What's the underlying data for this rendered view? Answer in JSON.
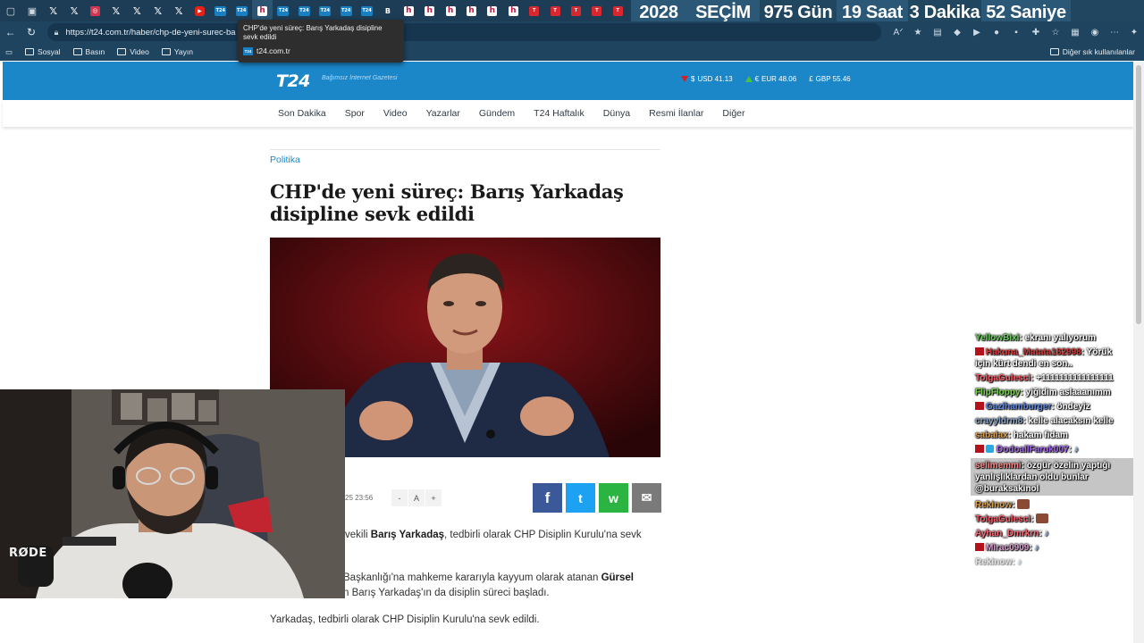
{
  "browser": {
    "countdown": [
      {
        "label": "2028",
        "alt": true
      },
      {
        "label": "SEÇİM",
        "alt": true
      },
      {
        "label": "975 Gün",
        "alt": false
      },
      {
        "label": "19 Saat",
        "alt": true
      },
      {
        "label": "3 Dakika",
        "alt": false
      },
      {
        "label": "52 Saniye",
        "alt": true
      }
    ],
    "url": "https://t24.com.tr/haber/chp-de-yeni-surec-ba",
    "tooltip": {
      "title": "CHP'de yeni süreç: Barış Yarkadaş disipline sevk edildi",
      "host": "t24.com.tr",
      "favicon_text": "T24"
    },
    "bookmarks": [
      "Sosyal",
      "Basın",
      "Video",
      "Yayın"
    ],
    "bookmarks_other": "Diğer sık kullanılanlar"
  },
  "site": {
    "logo": "T24",
    "slogan": "Bağımsız İnternet Gazetesi",
    "rates": [
      {
        "symbol": "$",
        "label": "USD 41.13",
        "trend": "down"
      },
      {
        "symbol": "€",
        "label": "EUR 48.06",
        "trend": "up"
      },
      {
        "symbol": "£",
        "label": "GBP 55.46",
        "trend": "none"
      }
    ],
    "nav": [
      "Son Dakika",
      "Spor",
      "Video",
      "Yazarlar",
      "Gündem",
      "T24 Haftalık",
      "Dünya",
      "Resmi İlanlar",
      "Diğer"
    ]
  },
  "article": {
    "category": "Politika",
    "headline": "CHP'de yeni süreç: Barış Yarkadaş disipline sevk edildi",
    "date_fragment": "25 23:56",
    "font_controls": [
      "-",
      "A",
      "+"
    ],
    "share": {
      "facebook": "f",
      "twitter": "t",
      "whatsapp": "w",
      "mail": "✉"
    },
    "paragraphs": {
      "p1_pre": "vekili ",
      "p1_bold": "Barış Yarkadaş",
      "p1_post": ", tedbirli olarak CHP Disiplin Kurulu'na sevk",
      "p2_pre": "Başkanlığı'na mahkeme kararıyla kayyum olarak atanan ",
      "p2_bold": "Gürsel",
      "p2_line2": "n Barış Yarkadaş'ın da disiplin süreci başladı.",
      "p3": "Yarkadaş, tedbirli olarak CHP Disiplin Kurulu'na sevk edildi."
    }
  },
  "overlay": {
    "webcam_brand": "RØDE"
  },
  "chat": [
    {
      "user": "YellowBixi",
      "color": "#6bd35c",
      "badge": false,
      "text": "ekranı yalıyorum",
      "highlight": false,
      "wrap": false
    },
    {
      "user": "Hakuna_Matata182998",
      "color": "#d83a3a",
      "badge": true,
      "text": "Yörük için kürt dendi en son..",
      "highlight": false,
      "wrap": true
    },
    {
      "user": "TolgaGulesci",
      "color": "#ff5c6a",
      "badge": false,
      "text": "+1111111111111111",
      "highlight": false,
      "wrap": false
    },
    {
      "user": "FlipFloppy",
      "color": "#7ad14f",
      "badge": false,
      "text": "yiğidim aslaaanımm",
      "highlight": false,
      "wrap": false
    },
    {
      "user": "Gazihamburger",
      "color": "#5b86e6",
      "badge": true,
      "text": "öndeyiz",
      "highlight": false,
      "wrap": false
    },
    {
      "user": "crayyldrm8",
      "color": "#8aa4c8",
      "badge": false,
      "text": "kelle alacaksın kelle",
      "highlight": false,
      "wrap": false
    },
    {
      "user": "sabalax",
      "color": "#e0a14b",
      "badge": false,
      "text": "hakam fidam",
      "highlight": false,
      "wrap": false
    },
    {
      "user": "DodoallFaruk007",
      "color": "#a368e8",
      "badge": true,
      "text": "",
      "highlight": false,
      "wrap": false,
      "emote": "♪"
    },
    {
      "user": "selimemmi",
      "color": "#ff8a8a",
      "badge": false,
      "text": "özgür özelin yaptığı yanlışlıklardan oldu bunlar @buraksakinol",
      "highlight": true,
      "wrap": true
    },
    {
      "user": "Rekinow",
      "color": "#e0a14b",
      "badge": false,
      "text": "",
      "highlight": false,
      "wrap": false,
      "emote_box": true
    },
    {
      "user": "TolgaGulesci",
      "color": "#ff5c6a",
      "badge": false,
      "text": "",
      "highlight": false,
      "wrap": false,
      "emote_box": true
    },
    {
      "user": "Ayhan_Dmrkrn",
      "color": "#ff6b7a",
      "badge": false,
      "text": "",
      "highlight": false,
      "wrap": false,
      "emote": "♪"
    },
    {
      "user": "Mirac0909",
      "color": "#d8a0d0",
      "badge": true,
      "text": "",
      "highlight": false,
      "wrap": false,
      "emote": "♪"
    },
    {
      "user": "Rekinow",
      "color": "#bbbbbb",
      "badge": false,
      "text": "",
      "highlight": false,
      "wrap": false,
      "emote": "♪",
      "faded": true
    }
  ]
}
